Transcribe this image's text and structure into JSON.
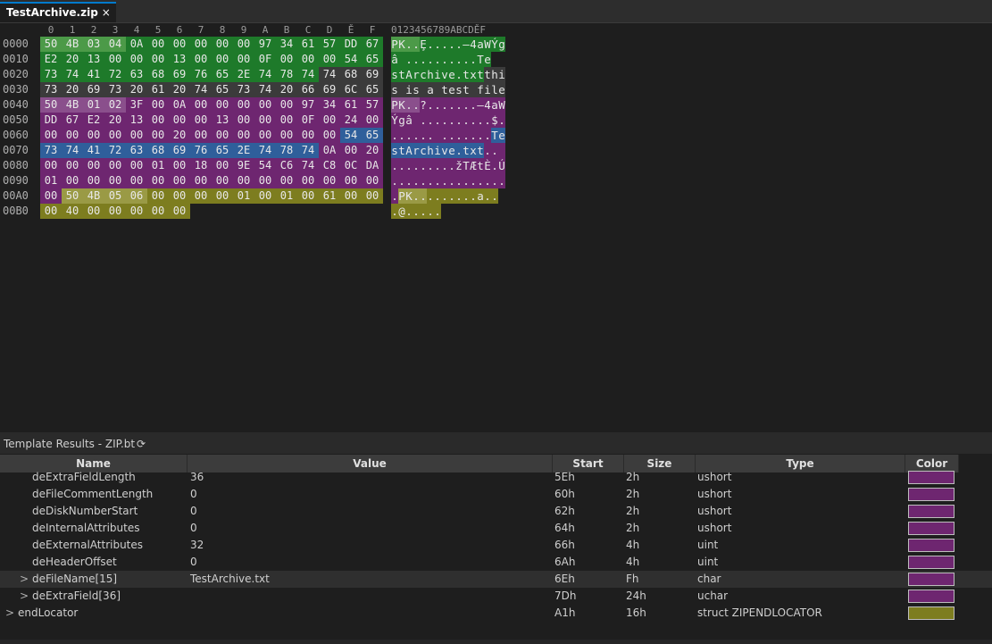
{
  "tab": {
    "title": "TestArchive.zip",
    "close": "×"
  },
  "colors": {
    "green": "#1e7a2a",
    "green_light": "#4c9a48",
    "purple": "#6e2670",
    "purple_light": "#8a4f8c",
    "blue": "#2f5f9b",
    "olive": "#7d7d1f",
    "olive_light": "#9a9a45",
    "gray": "#3b3b3b"
  },
  "hex": {
    "columns": [
      "0",
      "1",
      "2",
      "3",
      "4",
      "5",
      "6",
      "7",
      "8",
      "9",
      "A",
      "B",
      "C",
      "D",
      "Ě",
      "F"
    ],
    "ascii_header": "0123456789ABCDĚF",
    "rows": [
      {
        "addr": "0000",
        "bytes": [
          "50",
          "4B",
          "03",
          "04",
          "0A",
          "00",
          "00",
          "00",
          "00",
          "00",
          "97",
          "34",
          "61",
          "57",
          "DD",
          "67"
        ],
        "colors": [
          "gl",
          "gl",
          "gl",
          "gl",
          "g",
          "g",
          "g",
          "g",
          "g",
          "g",
          "g",
          "g",
          "g",
          "g",
          "g",
          "g"
        ],
        "ascii": "PK..Ȩ.....—4aWÝg",
        "ascii_colors": [
          "gl",
          "gl",
          "gl",
          "gl",
          "g",
          "g",
          "g",
          "g",
          "g",
          "g",
          "g",
          "g",
          "g",
          "g",
          "g",
          "g"
        ]
      },
      {
        "addr": "0010",
        "bytes": [
          "E2",
          "20",
          "13",
          "00",
          "00",
          "00",
          "13",
          "00",
          "00",
          "00",
          "0F",
          "00",
          "00",
          "00",
          "54",
          "65"
        ],
        "colors": [
          "g",
          "g",
          "g",
          "g",
          "g",
          "g",
          "g",
          "g",
          "g",
          "g",
          "g",
          "g",
          "g",
          "g",
          "g",
          "g"
        ],
        "ascii": "â ..........Te",
        "ascii_colors": [
          "g",
          "g",
          "g",
          "g",
          "g",
          "g",
          "g",
          "g",
          "g",
          "g",
          "g",
          "g",
          "g",
          "g",
          "g",
          "g"
        ]
      },
      {
        "addr": "0020",
        "bytes": [
          "73",
          "74",
          "41",
          "72",
          "63",
          "68",
          "69",
          "76",
          "65",
          "2E",
          "74",
          "78",
          "74",
          "74",
          "68",
          "69"
        ],
        "colors": [
          "g",
          "g",
          "g",
          "g",
          "g",
          "g",
          "g",
          "g",
          "g",
          "g",
          "g",
          "g",
          "g",
          "n",
          "n",
          "n"
        ],
        "ascii": "stArchive.txtthi",
        "ascii_colors": [
          "g",
          "g",
          "g",
          "g",
          "g",
          "g",
          "g",
          "g",
          "g",
          "g",
          "g",
          "g",
          "g",
          "n",
          "n",
          "n"
        ]
      },
      {
        "addr": "0030",
        "bytes": [
          "73",
          "20",
          "69",
          "73",
          "20",
          "61",
          "20",
          "74",
          "65",
          "73",
          "74",
          "20",
          "66",
          "69",
          "6C",
          "65"
        ],
        "colors": [
          "n",
          "n",
          "n",
          "n",
          "n",
          "n",
          "n",
          "n",
          "n",
          "n",
          "n",
          "n",
          "n",
          "n",
          "n",
          "n"
        ],
        "ascii": "s is a test file",
        "ascii_colors": [
          "n",
          "n",
          "n",
          "n",
          "n",
          "n",
          "n",
          "n",
          "n",
          "n",
          "n",
          "n",
          "n",
          "n",
          "n",
          "n"
        ]
      },
      {
        "addr": "0040",
        "bytes": [
          "50",
          "4B",
          "01",
          "02",
          "3F",
          "00",
          "0A",
          "00",
          "00",
          "00",
          "00",
          "00",
          "97",
          "34",
          "61",
          "57"
        ],
        "colors": [
          "pl",
          "pl",
          "pl",
          "pl",
          "p",
          "p",
          "p",
          "p",
          "p",
          "p",
          "p",
          "p",
          "p",
          "p",
          "p",
          "p"
        ],
        "ascii": "PK..?.......—4aW",
        "ascii_colors": [
          "pl",
          "pl",
          "pl",
          "pl",
          "p",
          "p",
          "p",
          "p",
          "p",
          "p",
          "p",
          "p",
          "p",
          "p",
          "p",
          "p"
        ]
      },
      {
        "addr": "0050",
        "bytes": [
          "DD",
          "67",
          "E2",
          "20",
          "13",
          "00",
          "00",
          "00",
          "13",
          "00",
          "00",
          "00",
          "0F",
          "00",
          "24",
          "00"
        ],
        "colors": [
          "p",
          "p",
          "p",
          "p",
          "p",
          "p",
          "p",
          "p",
          "p",
          "p",
          "p",
          "p",
          "p",
          "p",
          "p",
          "p"
        ],
        "ascii": "Ýgâ ..........$.",
        "ascii_colors": [
          "p",
          "p",
          "p",
          "p",
          "p",
          "p",
          "p",
          "p",
          "p",
          "p",
          "p",
          "p",
          "p",
          "p",
          "p",
          "p"
        ]
      },
      {
        "addr": "0060",
        "bytes": [
          "00",
          "00",
          "00",
          "00",
          "00",
          "00",
          "20",
          "00",
          "00",
          "00",
          "00",
          "00",
          "00",
          "00",
          "54",
          "65"
        ],
        "colors": [
          "p",
          "p",
          "p",
          "p",
          "p",
          "p",
          "p",
          "p",
          "p",
          "p",
          "p",
          "p",
          "p",
          "p",
          "b",
          "b"
        ],
        "ascii": "...... .......Te",
        "ascii_colors": [
          "p",
          "p",
          "p",
          "p",
          "p",
          "p",
          "p",
          "p",
          "p",
          "p",
          "p",
          "p",
          "p",
          "p",
          "b",
          "b"
        ]
      },
      {
        "addr": "0070",
        "bytes": [
          "73",
          "74",
          "41",
          "72",
          "63",
          "68",
          "69",
          "76",
          "65",
          "2E",
          "74",
          "78",
          "74",
          "0A",
          "00",
          "20"
        ],
        "colors": [
          "b",
          "b",
          "b",
          "b",
          "b",
          "b",
          "b",
          "b",
          "b",
          "b",
          "b",
          "b",
          "b",
          "p",
          "p",
          "p"
        ],
        "ascii": "stArchive.txt.. ",
        "ascii_colors": [
          "b",
          "b",
          "b",
          "b",
          "b",
          "b",
          "b",
          "b",
          "b",
          "b",
          "b",
          "b",
          "b",
          "p",
          "p",
          "p"
        ]
      },
      {
        "addr": "0080",
        "bytes": [
          "00",
          "00",
          "00",
          "00",
          "00",
          "01",
          "00",
          "18",
          "00",
          "9E",
          "54",
          "C6",
          "74",
          "C8",
          "0C",
          "DA"
        ],
        "colors": [
          "p",
          "p",
          "p",
          "p",
          "p",
          "p",
          "p",
          "p",
          "p",
          "p",
          "p",
          "p",
          "p",
          "p",
          "p",
          "p"
        ],
        "ascii": ".........žTÆtÈ.Ú",
        "ascii_colors": [
          "p",
          "p",
          "p",
          "p",
          "p",
          "p",
          "p",
          "p",
          "p",
          "p",
          "p",
          "p",
          "p",
          "p",
          "p",
          "p"
        ]
      },
      {
        "addr": "0090",
        "bytes": [
          "01",
          "00",
          "00",
          "00",
          "00",
          "00",
          "00",
          "00",
          "00",
          "00",
          "00",
          "00",
          "00",
          "00",
          "00",
          "00"
        ],
        "colors": [
          "p",
          "p",
          "p",
          "p",
          "p",
          "p",
          "p",
          "p",
          "p",
          "p",
          "p",
          "p",
          "p",
          "p",
          "p",
          "p"
        ],
        "ascii": "................",
        "ascii_colors": [
          "p",
          "p",
          "p",
          "p",
          "p",
          "p",
          "p",
          "p",
          "p",
          "p",
          "p",
          "p",
          "p",
          "p",
          "p",
          "p"
        ]
      },
      {
        "addr": "00A0",
        "bytes": [
          "00",
          "50",
          "4B",
          "05",
          "06",
          "00",
          "00",
          "00",
          "00",
          "01",
          "00",
          "01",
          "00",
          "61",
          "00",
          "00"
        ],
        "colors": [
          "p",
          "ol",
          "ol",
          "ol",
          "ol",
          "o",
          "o",
          "o",
          "o",
          "o",
          "o",
          "o",
          "o",
          "o",
          "o",
          "o"
        ],
        "ascii": ".PK.........a..",
        "ascii_colors": [
          "p",
          "ol",
          "ol",
          "ol",
          "ol",
          "o",
          "o",
          "o",
          "o",
          "o",
          "o",
          "o",
          "o",
          "o",
          "o",
          "o"
        ]
      },
      {
        "addr": "00B0",
        "bytes": [
          "00",
          "40",
          "00",
          "00",
          "00",
          "00",
          "00"
        ],
        "colors": [
          "o",
          "o",
          "o",
          "o",
          "o",
          "o",
          "o"
        ],
        "ascii": ".@.....",
        "ascii_colors": [
          "o",
          "o",
          "o",
          "o",
          "o",
          "o",
          "o"
        ]
      }
    ]
  },
  "panel": {
    "title": "Template Results - ZIP.bt",
    "refresh_icon": "⟳"
  },
  "table": {
    "headers": {
      "name": "Name",
      "value": "Value",
      "start": "Start",
      "size": "Size",
      "type": "Type",
      "color": "Color"
    },
    "rows": [
      {
        "name": "deExtraFieldLength",
        "value": "36",
        "start": "5Eh",
        "size": "2h",
        "type": "ushort",
        "color": "#6e2670",
        "indent": 1,
        "expand": ""
      },
      {
        "name": "deFileCommentLength",
        "value": "0",
        "start": "60h",
        "size": "2h",
        "type": "ushort",
        "color": "#6e2670",
        "indent": 1,
        "expand": ""
      },
      {
        "name": "deDiskNumberStart",
        "value": "0",
        "start": "62h",
        "size": "2h",
        "type": "ushort",
        "color": "#6e2670",
        "indent": 1,
        "expand": ""
      },
      {
        "name": "deInternalAttributes",
        "value": "0",
        "start": "64h",
        "size": "2h",
        "type": "ushort",
        "color": "#6e2670",
        "indent": 1,
        "expand": ""
      },
      {
        "name": "deExternalAttributes",
        "value": "32",
        "start": "66h",
        "size": "4h",
        "type": "uint",
        "color": "#6e2670",
        "indent": 1,
        "expand": ""
      },
      {
        "name": "deHeaderOffset",
        "value": "0",
        "start": "6Ah",
        "size": "4h",
        "type": "uint",
        "color": "#6e2670",
        "indent": 1,
        "expand": ""
      },
      {
        "name": "deFileName[15]",
        "value": "TestArchive.txt",
        "start": "6Eh",
        "size": "Fh",
        "type": "char",
        "color": "#6e2670",
        "indent": 1,
        "expand": ">"
      },
      {
        "name": "deExtraField[36]",
        "value": "",
        "start": "7Dh",
        "size": "24h",
        "type": "uchar",
        "color": "#6e2670",
        "indent": 1,
        "expand": ">"
      },
      {
        "name": "endLocator",
        "value": "",
        "start": "A1h",
        "size": "16h",
        "type": "struct ZIPENDLOCATOR",
        "color": "#7d7d1f",
        "indent": 0,
        "expand": ">"
      }
    ]
  }
}
